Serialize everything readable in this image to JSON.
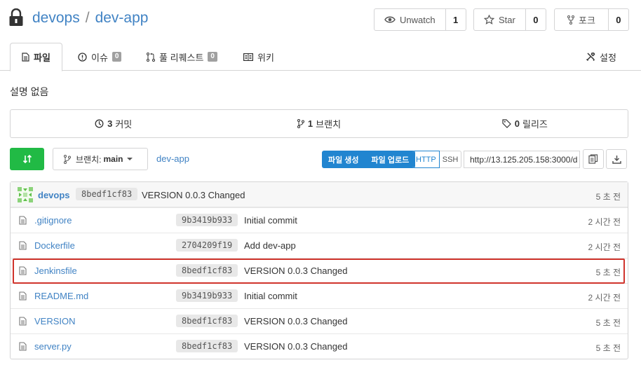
{
  "repo": {
    "owner": "devops",
    "separator": "/",
    "name": "dev-app"
  },
  "actions": {
    "watch": {
      "label": "Unwatch",
      "count": "1"
    },
    "star": {
      "label": "Star",
      "count": "0"
    },
    "fork": {
      "label": "포크",
      "count": "0"
    }
  },
  "tabs": [
    {
      "label": "파일",
      "badge": ""
    },
    {
      "label": "이슈",
      "badge": "0"
    },
    {
      "label": "풀 리퀘스트",
      "badge": "0"
    },
    {
      "label": "위키",
      "badge": ""
    },
    {
      "label": "설정",
      "badge": ""
    }
  ],
  "description": "설명 없음",
  "stats": {
    "commits": {
      "count": "3",
      "label": "커밋"
    },
    "branches": {
      "count": "1",
      "label": "브랜치"
    },
    "releases": {
      "count": "0",
      "label": "릴리즈"
    }
  },
  "toolbar": {
    "branch_label": "브랜치:",
    "branch_name": "main",
    "path": "dev-app",
    "new_file": "파일 생성",
    "upload_file": "파일 업로드",
    "http": "HTTP",
    "ssh": "SSH",
    "clone_url": "http://13.125.205.158:3000/d"
  },
  "latest_commit": {
    "user": "devops",
    "sha": "8bedf1cf83",
    "message": "VERSION 0.0.3 Changed",
    "age": "5 초 전"
  },
  "files": [
    {
      "name": ".gitignore",
      "sha": "9b3419b933",
      "message": "Initial commit",
      "age": "2 시간 전"
    },
    {
      "name": "Dockerfile",
      "sha": "2704209f19",
      "message": "Add dev-app",
      "age": "2 시간 전"
    },
    {
      "name": "Jenkinsfile",
      "sha": "8bedf1cf83",
      "message": "VERSION 0.0.3 Changed",
      "age": "5 초 전"
    },
    {
      "name": "README.md",
      "sha": "9b3419b933",
      "message": "Initial commit",
      "age": "2 시간 전"
    },
    {
      "name": "VERSION",
      "sha": "8bedf1cf83",
      "message": "VERSION 0.0.3 Changed",
      "age": "5 초 전"
    },
    {
      "name": "server.py",
      "sha": "8bedf1cf83",
      "message": "VERSION 0.0.3 Changed",
      "age": "5 초 전"
    }
  ],
  "colors": {
    "link": "#4183c4",
    "accent_green": "#21ba45",
    "accent_blue": "#2185d0",
    "highlight_red": "#d0342c"
  }
}
